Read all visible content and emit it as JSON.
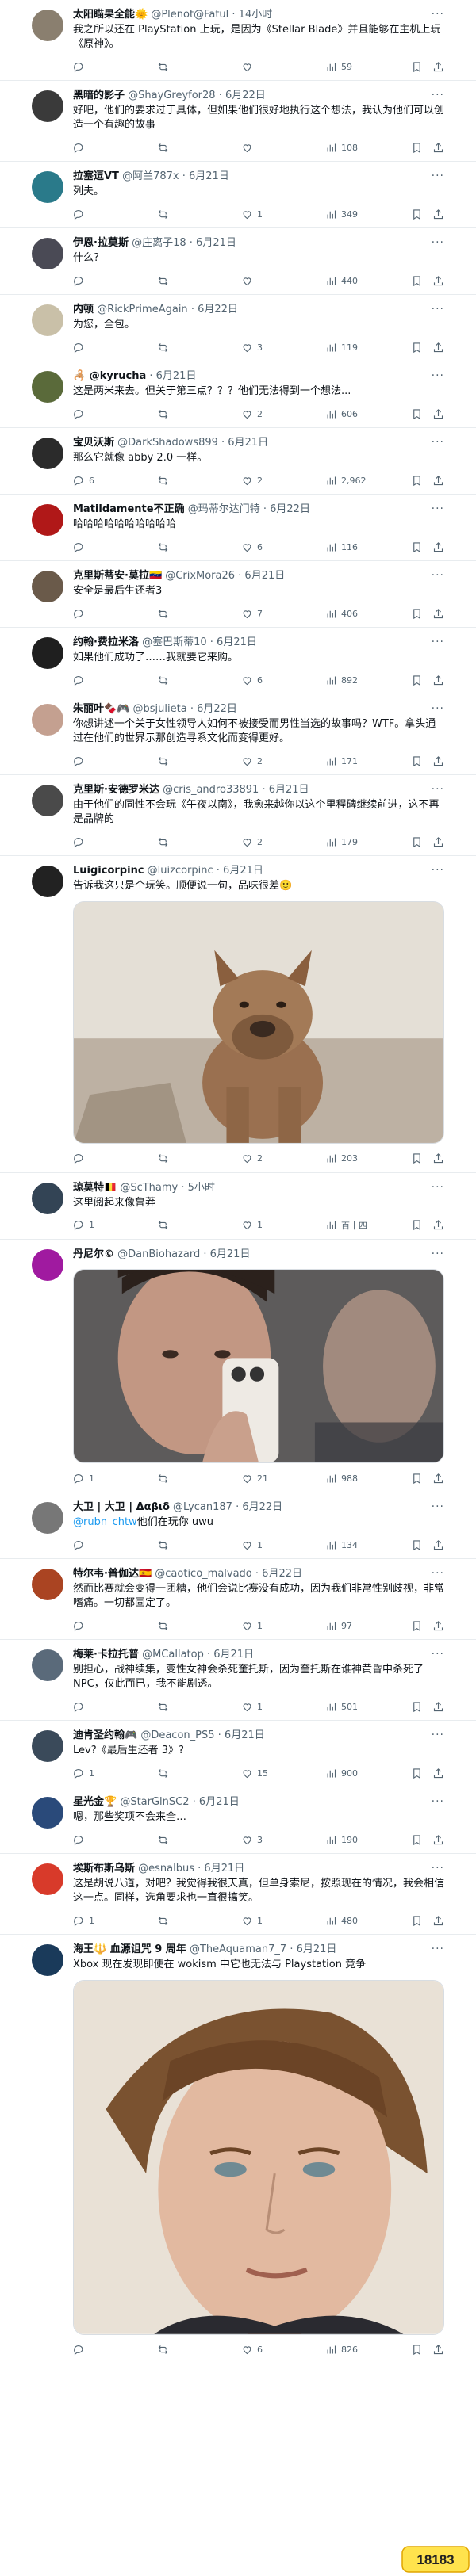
{
  "tweets": [
    {
      "name": "太阳瞄果全能🌞",
      "handle": "@Plenot@Fatul",
      "time": "· 14小时",
      "text": "我之所以还在 PlayStation 上玩，是因为《Stellar Blade》并且能够在主机上玩《原神》。",
      "replies": "",
      "retweets": "",
      "likes": "",
      "views": "59",
      "avatar": "#8a7f6f"
    },
    {
      "name": "黑暗的影子",
      "handle": "@ShayGreyfor28",
      "time": "· 6月22日",
      "text": "好吧，他们的要求过于具体，但如果他们很好地执行这个想法，我认为他们可以创造一个有趣的故事",
      "replies": "",
      "retweets": "",
      "likes": "",
      "views": "108",
      "avatar": "#3a3a3a"
    },
    {
      "name": "拉塞逗VT",
      "handle": "@阿兰787x",
      "time": "· 6月21日",
      "text": "列夫。",
      "replies": "",
      "retweets": "",
      "likes": "1",
      "views": "349",
      "avatar": "#2a7a8a"
    },
    {
      "name": "伊恩·拉莫斯",
      "handle": "@庄离子18",
      "time": "· 6月21日",
      "text": "什么?",
      "replies": "",
      "retweets": "",
      "likes": "",
      "views": "440",
      "avatar": "#4a4a55"
    },
    {
      "name": "内顿",
      "handle": "@RickPrimeAgain",
      "time": "· 6月22日",
      "text": "为您，全包。",
      "replies": "",
      "retweets": "",
      "likes": "3",
      "views": "119",
      "avatar": "#c9c0a8"
    },
    {
      "name": "🦂 @kyrucha",
      "handle": "",
      "time": "· 6月21日",
      "text": "这是两米来去。但关于第三点？？？他们无法得到一个想法...",
      "replies": "",
      "retweets": "",
      "likes": "2",
      "views": "606",
      "avatar": "#5a6a3a"
    },
    {
      "name": "宝贝沃斯",
      "handle": "@DarkShadows899",
      "time": "· 6月21日",
      "text": "那么它就像 abby 2.0 一样。",
      "replies": "6",
      "retweets": "",
      "likes": "2",
      "views": "2,962",
      "avatar": "#2b2b2b"
    },
    {
      "name": "Matildamente不正确",
      "handle": "@玛蒂尔达门特",
      "time": "· 6月22日",
      "text": "哈哈哈哈哈哈哈哈哈哈",
      "replies": "",
      "retweets": "",
      "likes": "6",
      "views": "116",
      "avatar": "#b01818"
    },
    {
      "name": "克里斯蒂安·莫拉🇻🇪",
      "handle": "@CrixMora26",
      "time": "· 6月21日",
      "text": "安全是最后生还者3",
      "replies": "",
      "retweets": "",
      "likes": "7",
      "views": "406",
      "avatar": "#6a5a4a"
    },
    {
      "name": "约翰·费拉米洛",
      "handle": "@塞巴斯蒂10",
      "time": "· 6月21日",
      "text": "如果他们成功了……我就要它来购。",
      "replies": "",
      "retweets": "",
      "likes": "6",
      "views": "892",
      "avatar": "#1f1f1f"
    },
    {
      "name": "朱丽叶🍫🎮",
      "handle": "@bsjulieta",
      "time": "· 6月22日",
      "text": "你想讲述一个关于女性领导人如何不被接受而男性当选的故事吗？WTF。拿头通过在他们的世界示那创造寻系文化而变得更好。",
      "replies": "",
      "retweets": "",
      "likes": "2",
      "views": "171",
      "avatar": "#c4a090"
    },
    {
      "name": "克里斯·安德罗米达",
      "handle": "@cris_andro33891",
      "time": "· 6月21日",
      "text": "由于他们的同性不会玩《午夜以南》，我愈来越你以这个里程碑继续前进，这不再是品牌的",
      "replies": "",
      "retweets": "",
      "likes": "2",
      "views": "179",
      "avatar": "#4a4a4a"
    },
    {
      "name": "Luigicorpinc",
      "handle": "@luizcorpinc",
      "time": "· 6月21日",
      "text": "告诉我这只是个玩笑。顺便说一句，品味很差🙂",
      "replies": "",
      "retweets": "",
      "likes": "2",
      "views": "203",
      "avatar": "#222222",
      "media": "dog"
    },
    {
      "name": "琼莫特🇧🇪",
      "handle": "@ScThamy",
      "time": "· 5小时",
      "text": "这里阅起来像鲁莽",
      "replies": "1",
      "retweets": "",
      "likes": "1",
      "views": "百十四",
      "avatar": "#334455"
    },
    {
      "name": "丹尼尔©",
      "handle": "@DanBiohazard",
      "time": "· 6月21日",
      "text": "",
      "replies": "1",
      "retweets": "",
      "likes": "21",
      "views": "988",
      "avatar": "#a01aa0",
      "media": "phone"
    },
    {
      "name": "大卫 | 大卫 | Δαβιδ",
      "handle": "@Lycan187",
      "time": "· 6月22日",
      "text": "@rubn_chtw他们在玩你 uwu",
      "replies": "",
      "retweets": "",
      "likes": "1",
      "views": "134",
      "avatar": "#777777"
    },
    {
      "name": "特尔韦·普伽达🇪🇸",
      "handle": "@caotico_malvado",
      "time": "· 6月22日",
      "text": "然而比赛就会变得一团糟，他们会说比赛没有成功，因为我们非常性别歧视，非常嗜痛。一切都固定了。",
      "replies": "",
      "retweets": "",
      "likes": "1",
      "views": "97",
      "avatar": "#aa4422"
    },
    {
      "name": "梅莱·卡拉托普",
      "handle": "@MCallatop",
      "time": "· 6月21日",
      "text": "别担心，战神续集，变性女神会杀死奎托斯，因为奎托斯在谁神黄昏中杀死了 NPC，仅此而已，我不能剧透。",
      "replies": "",
      "retweets": "",
      "likes": "1",
      "views": "501",
      "avatar": "#5a6a7a"
    },
    {
      "name": "迪肯圣约翰🎮",
      "handle": "@Deacon_PS5",
      "time": "· 6月21日",
      "text": "Lev?《最后生还者 3》?",
      "replies": "1",
      "retweets": "",
      "likes": "15",
      "views": "900",
      "avatar": "#3a4a5a"
    },
    {
      "name": "星光金🏆",
      "handle": "@StarGlnSC2",
      "time": "· 6月21日",
      "text": "嗯，那些奖项不会来全…",
      "replies": "",
      "retweets": "",
      "likes": "3",
      "views": "190",
      "avatar": "#2a4a7a"
    },
    {
      "name": "埃斯布斯乌斯",
      "handle": "@esnalbus",
      "time": "· 6月21日",
      "text": "这是胡说八道，对吧？我觉得我很天真，但单身索尼，按照现在的情况，我会相信这一点。同样，选角要求也一直很搞笑。",
      "replies": "1",
      "retweets": "",
      "likes": "1",
      "views": "480",
      "avatar": "#d83a2a"
    },
    {
      "name": "海王🔱 血源诅咒 9 周年",
      "handle": "@TheAquaman7_7",
      "time": "· 6月21日",
      "text": "Xbox 现在发现即使在 wokism 中它也无法与 Playstation 竞争",
      "replies": "",
      "retweets": "",
      "likes": "6",
      "views": "826",
      "avatar": "#1a3a5a",
      "media": "face"
    }
  ],
  "watermark": "18183"
}
